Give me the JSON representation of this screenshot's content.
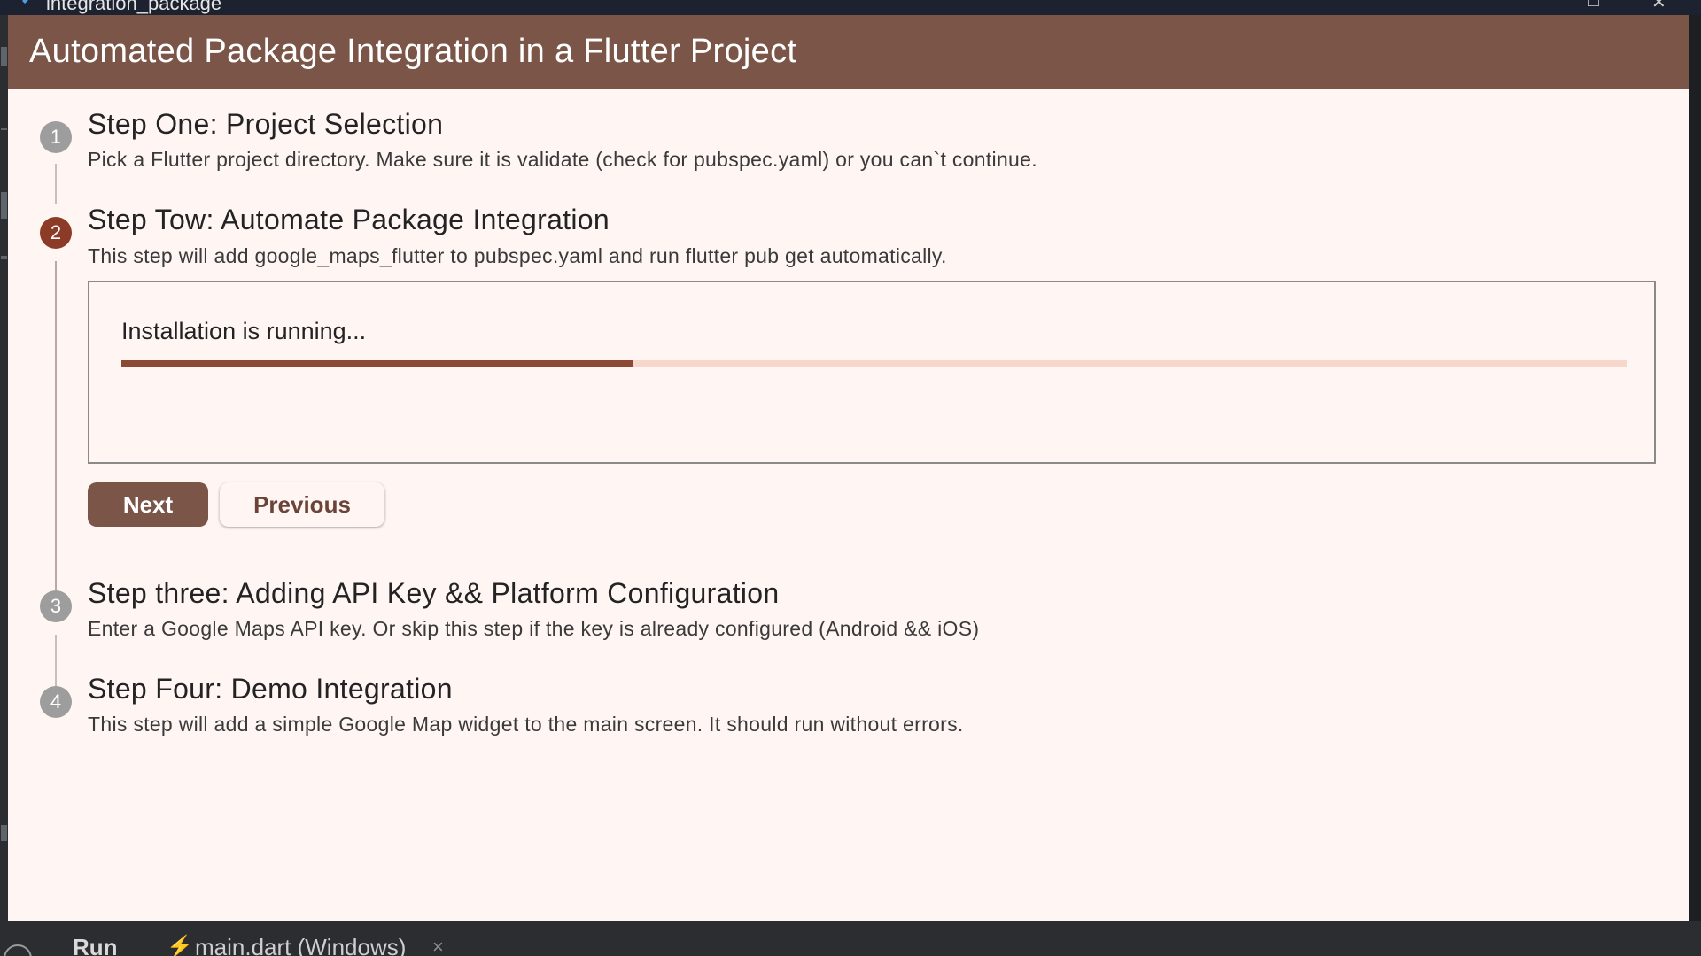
{
  "window": {
    "title": "integration_package"
  },
  "app": {
    "title": "Automated Package Integration in a Flutter Project"
  },
  "steps": [
    {
      "number": "1",
      "title": "Step One: Project Selection",
      "description": "Pick a Flutter project directory. Make sure it is validate (check for pubspec.yaml) or you can`t continue."
    },
    {
      "number": "2",
      "title": "Step Tow: Automate Package Integration",
      "description": "This step will add google_maps_flutter to pubspec.yaml and run flutter pub get automatically."
    },
    {
      "number": "3",
      "title": "Step three: Adding API Key && Platform Configuration",
      "description": "Enter a Google Maps API key. Or skip this step if the key is already configured (Android && iOS)"
    },
    {
      "number": "4",
      "title": "Step Four: Demo Integration",
      "description": "This step will add a simple Google Map widget to the main screen. It should run without errors."
    }
  ],
  "install": {
    "status": "Installation is running...",
    "progress": 0.34
  },
  "buttons": {
    "next": "Next",
    "previous": "Previous"
  },
  "bottombar": {
    "run": "Run",
    "tab": "main.dart (Windows)",
    "close": "×"
  },
  "colors": {
    "appbar": "#7a5548",
    "active_step": "#8c3b26",
    "inactive_step": "#9d9d9d",
    "progress_fill": "#8c4a35",
    "progress_track": "#f7d6cb",
    "background": "#fff6f3"
  }
}
